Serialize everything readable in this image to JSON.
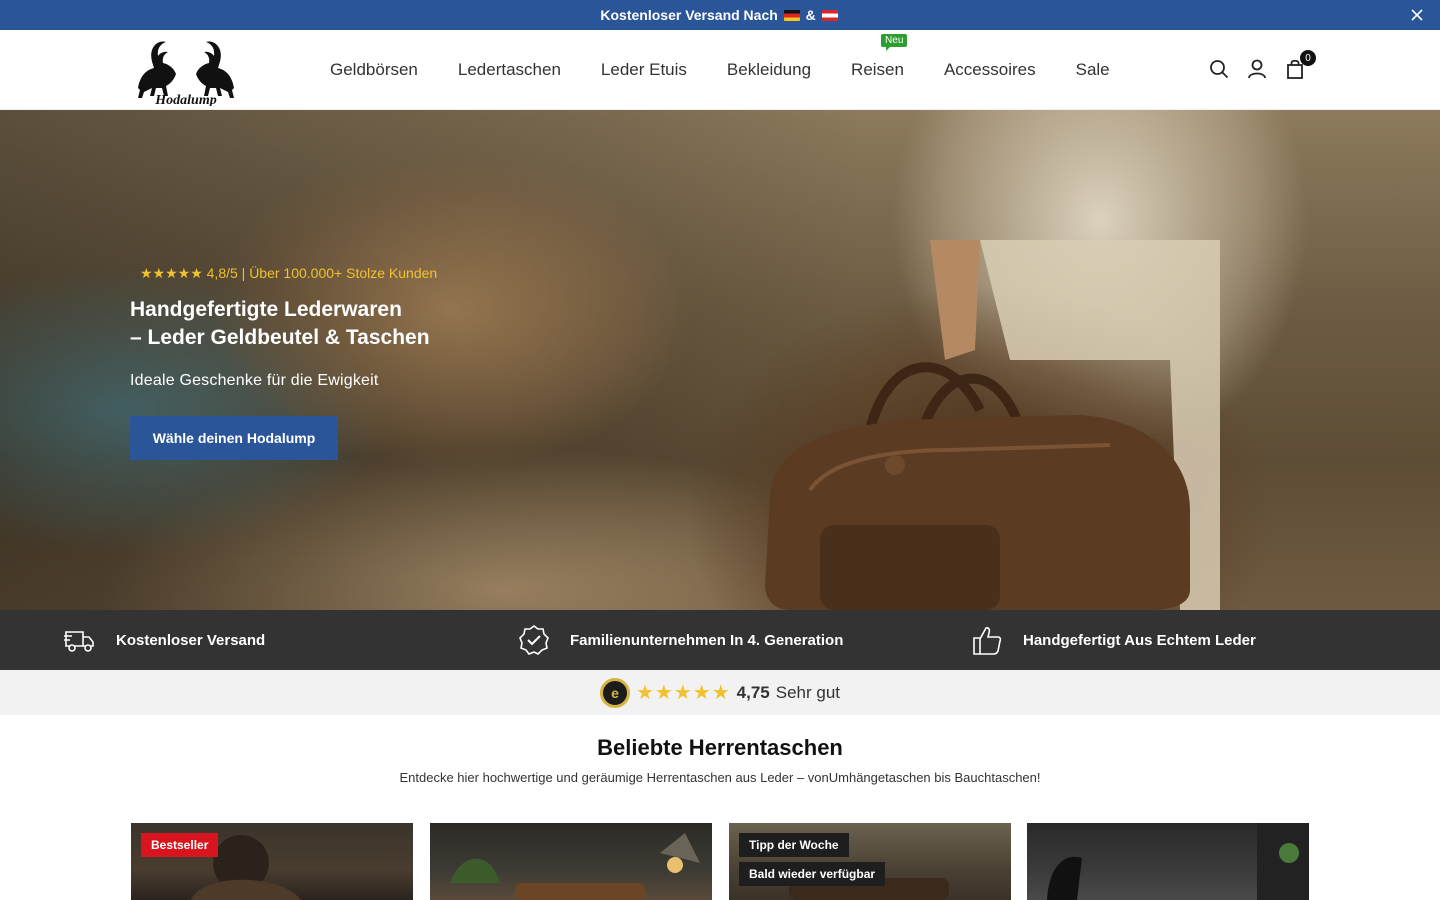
{
  "announcement": {
    "text_before": "Kostenloser Versand Nach",
    "text_and": "&"
  },
  "header": {
    "logo_alt": "Hodalump",
    "nav": [
      {
        "label": "Geldbörsen"
      },
      {
        "label": "Ledertaschen"
      },
      {
        "label": "Leder Etuis"
      },
      {
        "label": "Bekleidung"
      },
      {
        "label": "Reisen",
        "badge": "Neu"
      },
      {
        "label": "Accessoires"
      },
      {
        "label": "Sale"
      }
    ],
    "cart_count": "0"
  },
  "hero": {
    "rating": "★★★★★ 4,8/5 | Über 100.000+ Stolze Kunden",
    "title_line1": "Handgefertigte Lederwaren",
    "title_line2": "– Leder Geldbeutel & Taschen",
    "subtitle": "Ideale Geschenke für die Ewigkeit",
    "cta": "Wähle deinen Hodalump"
  },
  "usp": [
    {
      "label": "Kostenloser Versand",
      "icon": "truck-icon"
    },
    {
      "label": "Familienunternehmen In 4. Generation",
      "icon": "badge-check-icon"
    },
    {
      "label": "Handgefertigt Aus Echtem Leder",
      "icon": "thumbs-up-icon"
    }
  ],
  "trust": {
    "seal": "e",
    "stars": "★★★★★",
    "score": "4,75",
    "verdict": "Sehr gut"
  },
  "section": {
    "title": "Beliebte Herrentaschen",
    "subtitle": "Entdecke hier hochwertige und geräumige Herrentaschen aus Leder – vonUmhängetaschen bis Bauchtaschen!"
  },
  "cards": [
    {
      "badges": [
        "Bestseller"
      ]
    },
    {
      "badges": []
    },
    {
      "badges": [
        "Tipp der Woche",
        "Bald wieder verfügbar"
      ]
    },
    {
      "badges": []
    }
  ],
  "colors": {
    "brand_blue": "#2a5699",
    "usp_bg": "#333333",
    "star_gold": "#f2c12e",
    "badge_red": "#d8151e"
  }
}
